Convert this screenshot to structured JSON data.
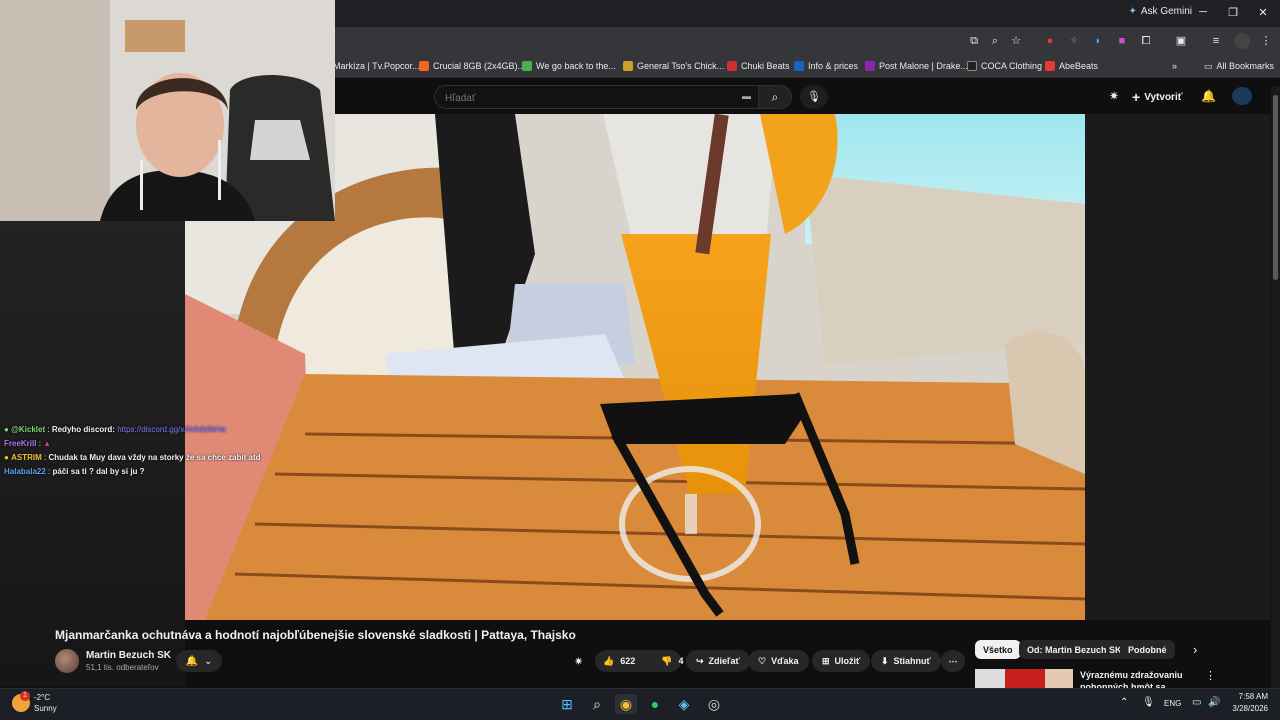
{
  "browser": {
    "ask_gemini": "Ask Gemini",
    "bookmarks": [
      {
        "label": "Markíza | Tv.Popcor...",
        "color": "#e8eaed"
      },
      {
        "label": "Crucial 8GB (2x4GB)...",
        "color": "#f26522"
      },
      {
        "label": "We go back to the...",
        "color": "#4caf50"
      },
      {
        "label": "General Tso's Chick...",
        "color": "#c9a227"
      },
      {
        "label": "Chuki Beats",
        "color": "#d32f2f"
      },
      {
        "label": "Info & prices",
        "color": "#1565c0"
      },
      {
        "label": "Post Malone | Drake...",
        "color": "#8e24aa"
      },
      {
        "label": "COCA Clothing",
        "color": "#222222"
      },
      {
        "label": "AbeBeats",
        "color": "#e53935"
      }
    ],
    "all_bookmarks": "All Bookmarks"
  },
  "youtube": {
    "search_placeholder": "Hľadať",
    "create_label": "Vytvoriť",
    "video_title": "Mjanmarčanka ochutnáva a hodnotí najobľúbenejšie slovenské sladkosti | Pattaya, Thajsko",
    "channel_name": "Martin Bezuch SK",
    "subscribers": "51,1 tis. odberateľov",
    "likes": "622",
    "dislikes": "4",
    "actions": {
      "share": "Zdieľať",
      "thanks": "Vďaka",
      "save": "Uložiť",
      "download": "Stiahnuť"
    },
    "chips": [
      "Všetko",
      "Od: Martin Bezuch SK",
      "Podobné"
    ],
    "recommended_title": "Výraznému zdražovaniu pohonných hmôt sa nevyhnem"
  },
  "chat": [
    {
      "name": "@Kicklet",
      "name_color": "#7cd67c",
      "message": "Redyho discord:",
      "link": "https://discord.gg/xAh9dk8kHa"
    },
    {
      "name": "FreeKrill",
      "name_color": "#b070f0",
      "message": ""
    },
    {
      "name": "ASTRIM",
      "name_color": "#f0c040",
      "message": "Chudak ta Muy dava vždy na storky že sa chce zabit atd"
    },
    {
      "name": "Halabala22",
      "name_color": "#5aa0f0",
      "message": "páči sa ti ? dal by si ju ?"
    }
  ],
  "taskbar": {
    "temperature": "-2°C",
    "weather": "Sunny",
    "language": "ENG",
    "time": "7:58 AM",
    "date": "3/28/2026",
    "weather_badge": "1"
  },
  "colors": {
    "accent_red": "#ff0000",
    "chat_link": "#7b7bff"
  }
}
